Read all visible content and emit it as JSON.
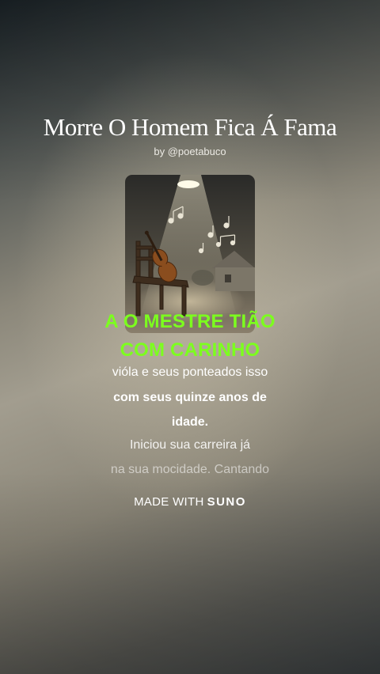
{
  "song": {
    "title": "Morre O Homem Fica Á Fama",
    "byline": "by @poetabuco"
  },
  "cover_art": {
    "icon": "violin-on-chair-spotlight-image"
  },
  "lyrics": {
    "highlight_line_1": "A O MESTRE TIÃO",
    "highlight_line_2": "COM CARINHO",
    "line_1": "vióla e seus ponteados isso",
    "line_2": "com seus quinze anos de",
    "line_3": "idade.",
    "line_4": "Iniciou sua carreira já",
    "line_5": "na sua mocidade. Cantando"
  },
  "footer": {
    "made_with": "MADE WITH",
    "brand": "SUNO"
  },
  "colors": {
    "highlight": "#7cff1e",
    "text": "#ffffff"
  }
}
